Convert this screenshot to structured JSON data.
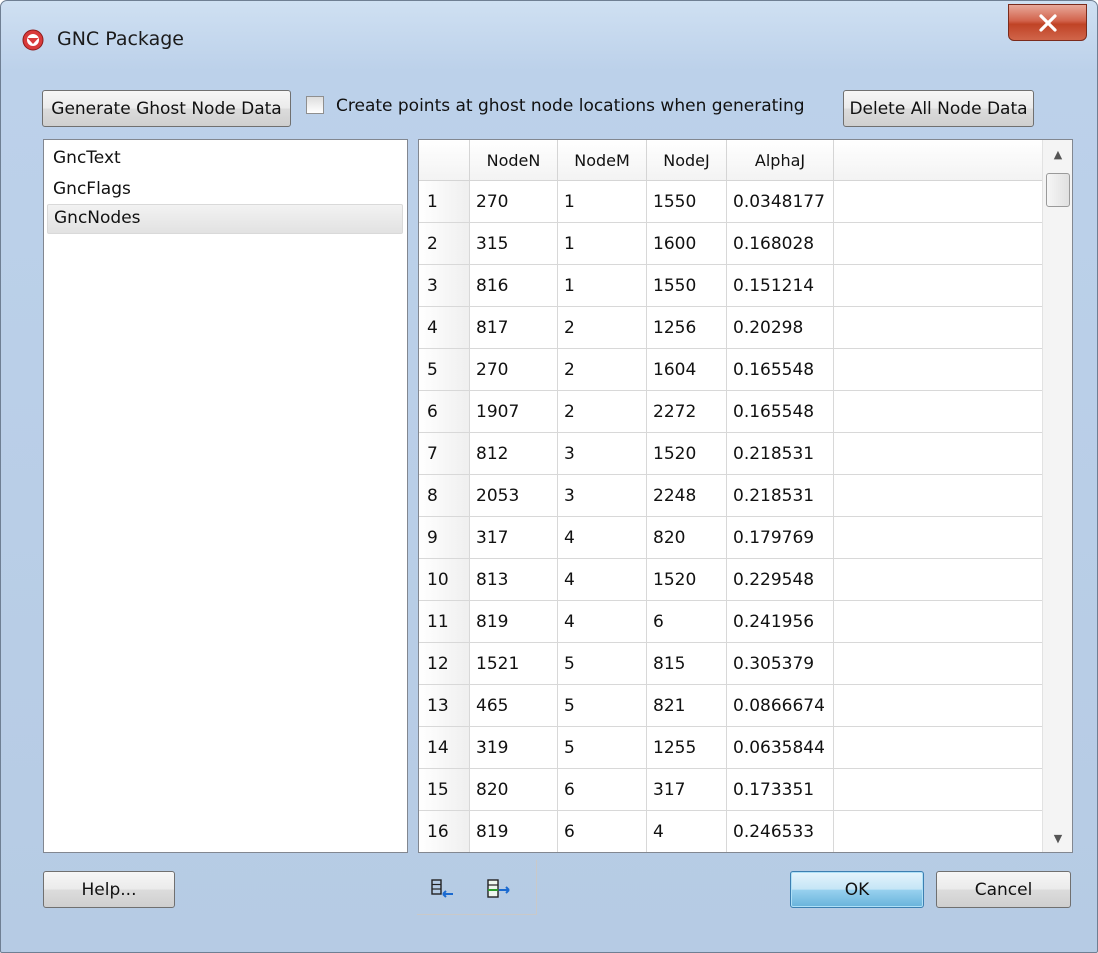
{
  "window": {
    "title": "GNC Package"
  },
  "toolbar": {
    "generate_button": "Generate Ghost Node Data",
    "create_points_checkbox": {
      "label": "Create points at ghost node locations when generating",
      "checked": false
    },
    "delete_button": "Delete All Node Data"
  },
  "sidebar": {
    "items": [
      {
        "label": "GncText",
        "selected": false
      },
      {
        "label": "GncFlags",
        "selected": false
      },
      {
        "label": "GncNodes",
        "selected": true
      }
    ]
  },
  "table": {
    "columns": [
      "",
      "NodeN",
      "NodeM",
      "NodeJ",
      "AlphaJ",
      ""
    ],
    "rows": [
      [
        "1",
        "270",
        "1",
        "1550",
        "0.0348177"
      ],
      [
        "2",
        "315",
        "1",
        "1600",
        "0.168028"
      ],
      [
        "3",
        "816",
        "1",
        "1550",
        "0.151214"
      ],
      [
        "4",
        "817",
        "2",
        "1256",
        "0.20298"
      ],
      [
        "5",
        "270",
        "2",
        "1604",
        "0.165548"
      ],
      [
        "6",
        "1907",
        "2",
        "2272",
        "0.165548"
      ],
      [
        "7",
        "812",
        "3",
        "1520",
        "0.218531"
      ],
      [
        "8",
        "2053",
        "3",
        "2248",
        "0.218531"
      ],
      [
        "9",
        "317",
        "4",
        "820",
        "0.179769"
      ],
      [
        "10",
        "813",
        "4",
        "1520",
        "0.229548"
      ],
      [
        "11",
        "819",
        "4",
        "6",
        "0.241956"
      ],
      [
        "12",
        "1521",
        "5",
        "815",
        "0.305379"
      ],
      [
        "13",
        "465",
        "5",
        "821",
        "0.0866674"
      ],
      [
        "14",
        "319",
        "5",
        "1255",
        "0.0635844"
      ],
      [
        "15",
        "820",
        "6",
        "317",
        "0.173351"
      ],
      [
        "16",
        "819",
        "6",
        "4",
        "0.246533"
      ]
    ]
  },
  "footer": {
    "help_button": "Help...",
    "ok_button": "OK",
    "cancel_button": "Cancel",
    "icons": [
      "remove-rows-icon",
      "add-rows-icon"
    ]
  },
  "colors": {
    "title_bar": "#bcd1ea",
    "close_button": "#c8503a",
    "ok_button": "#98d1ef",
    "selected_item": "#e6e6e6"
  }
}
